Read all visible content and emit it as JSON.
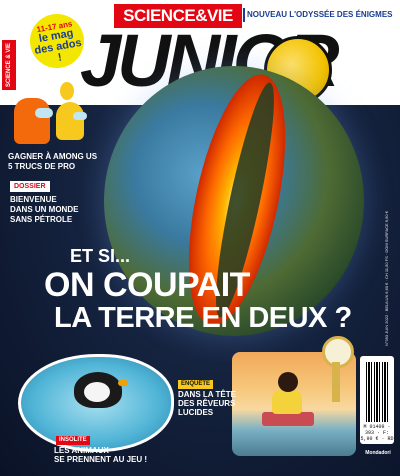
{
  "header": {
    "brand": "SCIENCE&VIE",
    "tagline": "NOUVEAU L'ODYSSÉE DES ÉNIGMES",
    "masthead": "JUNIOR",
    "age_badge_top": "11-17 ans",
    "age_badge_main": "le mag des ados !",
    "side_label": "SCIENCE & VIE"
  },
  "left_column": {
    "among_us": [
      "GAGNER À AMONG US",
      "5 TRUCS DE PRO"
    ],
    "dossier_tag": "DOSSIER",
    "dossier_text": [
      "BIENVENUE",
      "DANS UN MONDE",
      "SANS PÉTROLE"
    ]
  },
  "headline": {
    "line1": "ET SI...",
    "line2": "ON COUPAIT",
    "line3": "LA TERRE EN DEUX ?"
  },
  "features": {
    "animals_tag": "INSOLITE",
    "animals_text": [
      "LES ANIMAUX",
      "SE PRENNENT AU JEU !"
    ],
    "dreamers_tag": "ENQUÊTE",
    "dreamers_text": [
      "DANS LA TÊTE",
      "DES RÊVEURS",
      "LUCIDES"
    ]
  },
  "sidebar": {
    "issn_text": "N°393 JUIN 2022 · BEL/LUX 6,60 € · CH 11,50 FS · DOM SURFACE 6,90 €",
    "barcode_code": "M 01409 · 393 · F: 5,90 € · RD",
    "publisher": "Mondadori"
  },
  "colors": {
    "brand_red": "#e30613",
    "badge_yellow": "#f3e600",
    "navy": "#1a3d8f"
  }
}
